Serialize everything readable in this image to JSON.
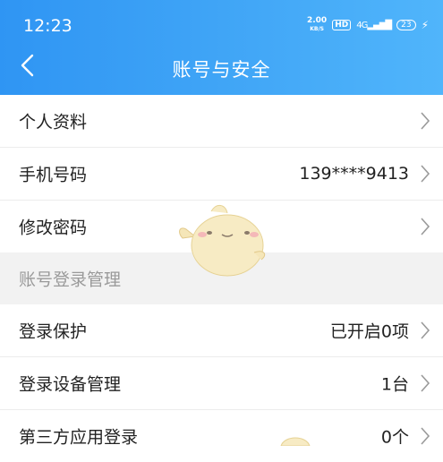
{
  "status_bar": {
    "time": "12:23",
    "speed_value": "2.00",
    "speed_unit": "KB/S",
    "hd": "HD",
    "network": "4G",
    "battery": "23"
  },
  "header": {
    "title": "账号与安全"
  },
  "rows": [
    {
      "label": "个人资料",
      "value": ""
    },
    {
      "label": "手机号码",
      "value": "139****9413"
    },
    {
      "label": "修改密码",
      "value": ""
    }
  ],
  "section": {
    "title": "账号登录管理"
  },
  "rows2": [
    {
      "label": "登录保护",
      "value": "已开启0项"
    },
    {
      "label": "登录设备管理",
      "value": "1台"
    },
    {
      "label": "第三方应用登录",
      "value": "0个"
    }
  ],
  "colors": {
    "header": "#3aa0f5",
    "section_bg": "#f2f2f2"
  }
}
